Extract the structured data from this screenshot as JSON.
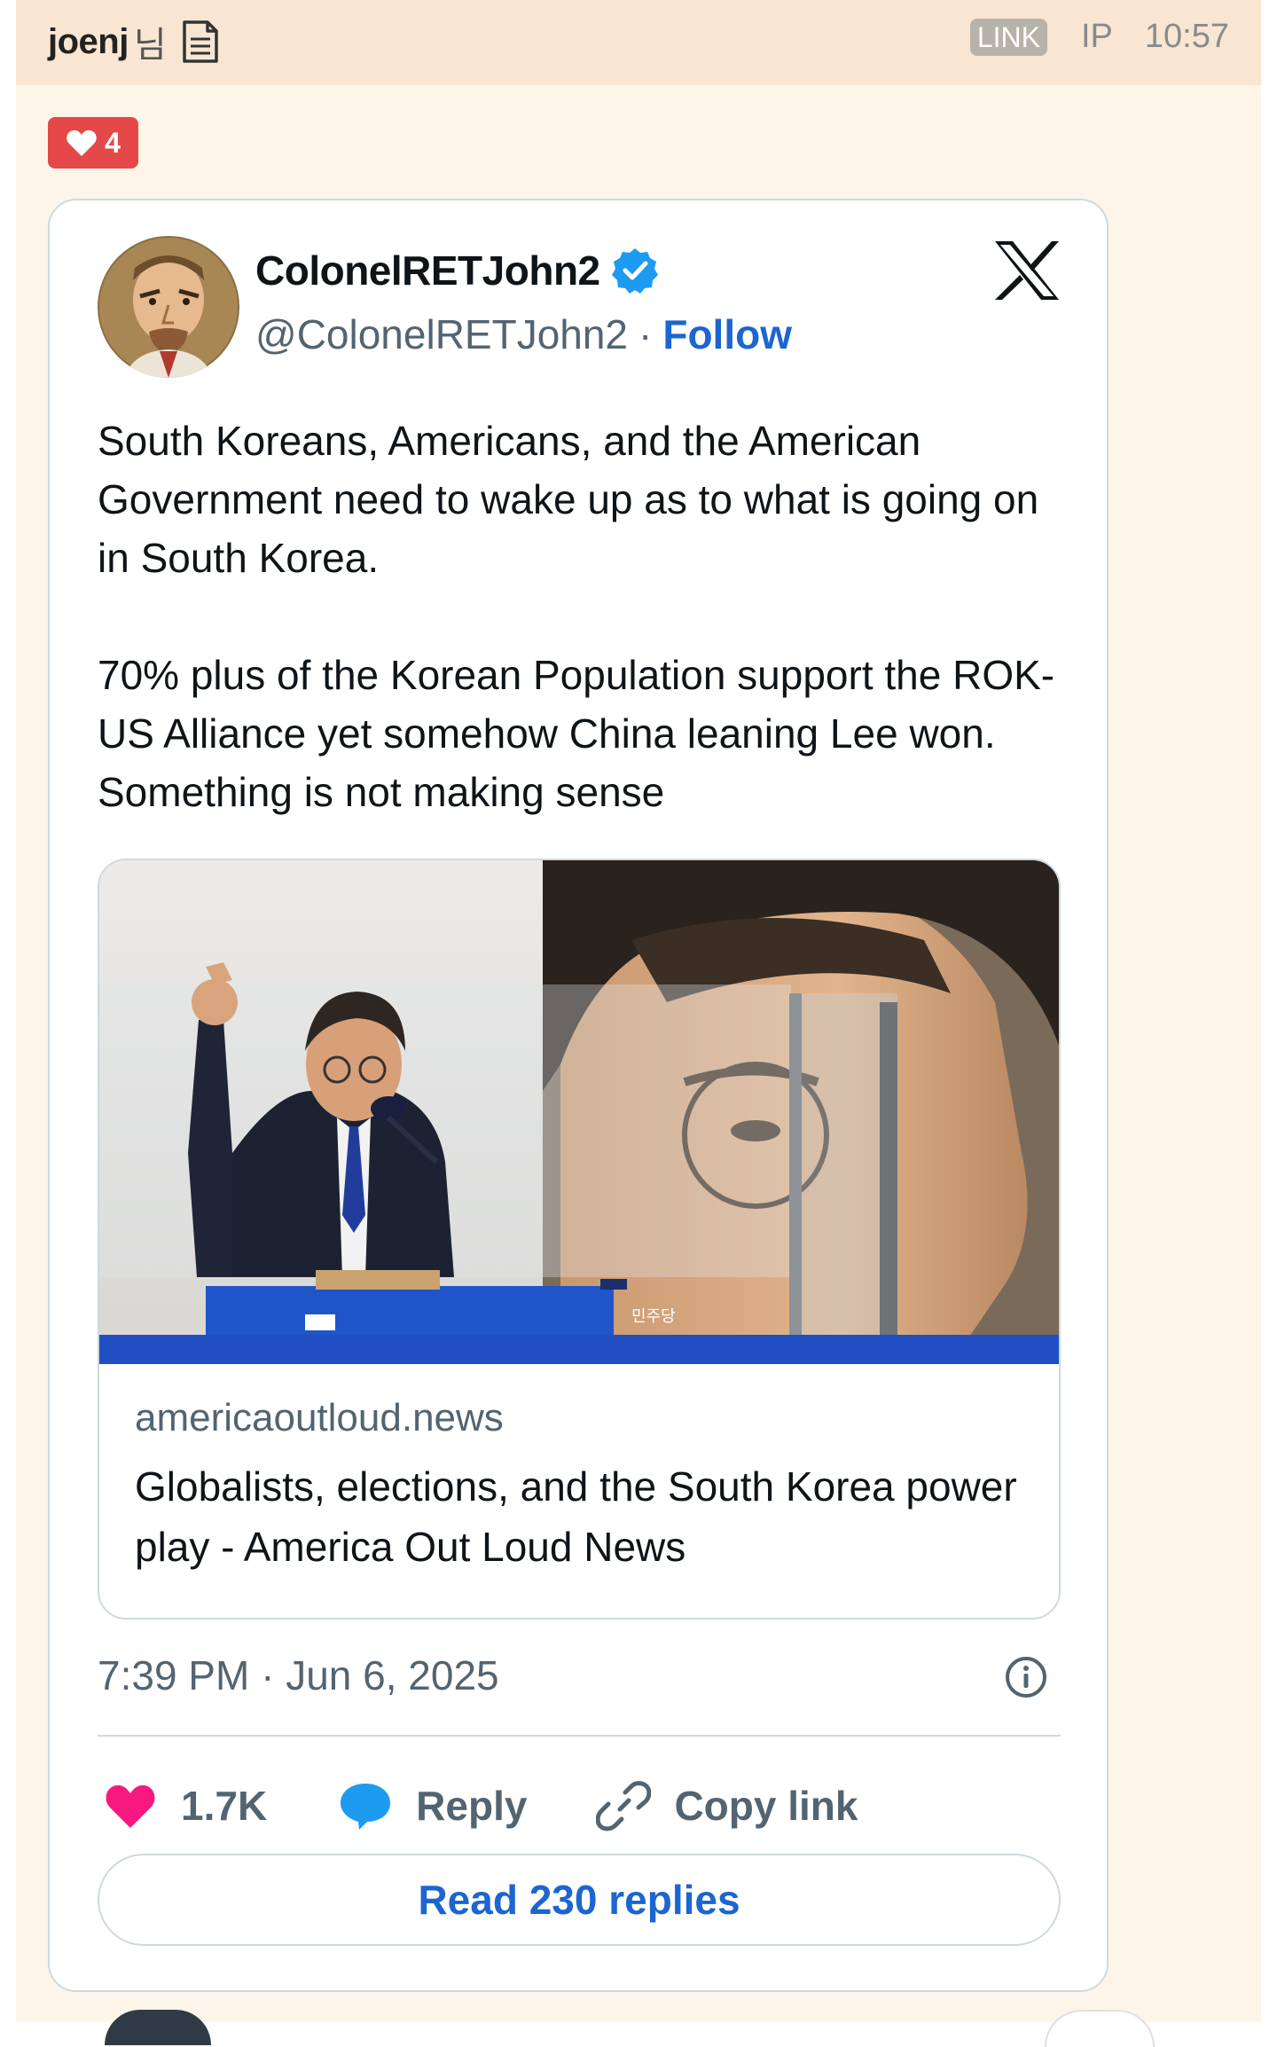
{
  "header": {
    "author": "joenj",
    "author_suffix": "님",
    "doc_icon": "document-icon",
    "link_badge": "LINK",
    "ip_label": "IP",
    "time": "10:57"
  },
  "likes": {
    "icon": "heart-icon",
    "count": "4"
  },
  "tweet": {
    "display_name": "ColonelRETJohn2",
    "handle": "@ColonelRETJohn2",
    "separator": "·",
    "follow_label": "Follow",
    "text": "South Koreans, Americans, and the American Government need to wake up as to what is going on in South Korea.\n\n70% plus of the Korean Population support the ROK-US Alliance yet somehow China leaning Lee won.  Something is not making sense",
    "card": {
      "domain": "americaoutloud.news",
      "title": "Globalists, elections, and the South Korea power play - America Out Loud News"
    },
    "timestamp": "7:39 PM · Jun 6, 2025",
    "like_count": "1.7K",
    "reply_label": "Reply",
    "copy_label": "Copy link",
    "read_replies_label": "Read 230 replies"
  },
  "colors": {
    "header_bg": "#f8e6d2",
    "page_bg": "#fdf5ea",
    "badge_red": "#e54848",
    "link_blue": "#1d65d0",
    "verified_blue": "#1d9bf0",
    "heart_pink": "#f91880"
  }
}
